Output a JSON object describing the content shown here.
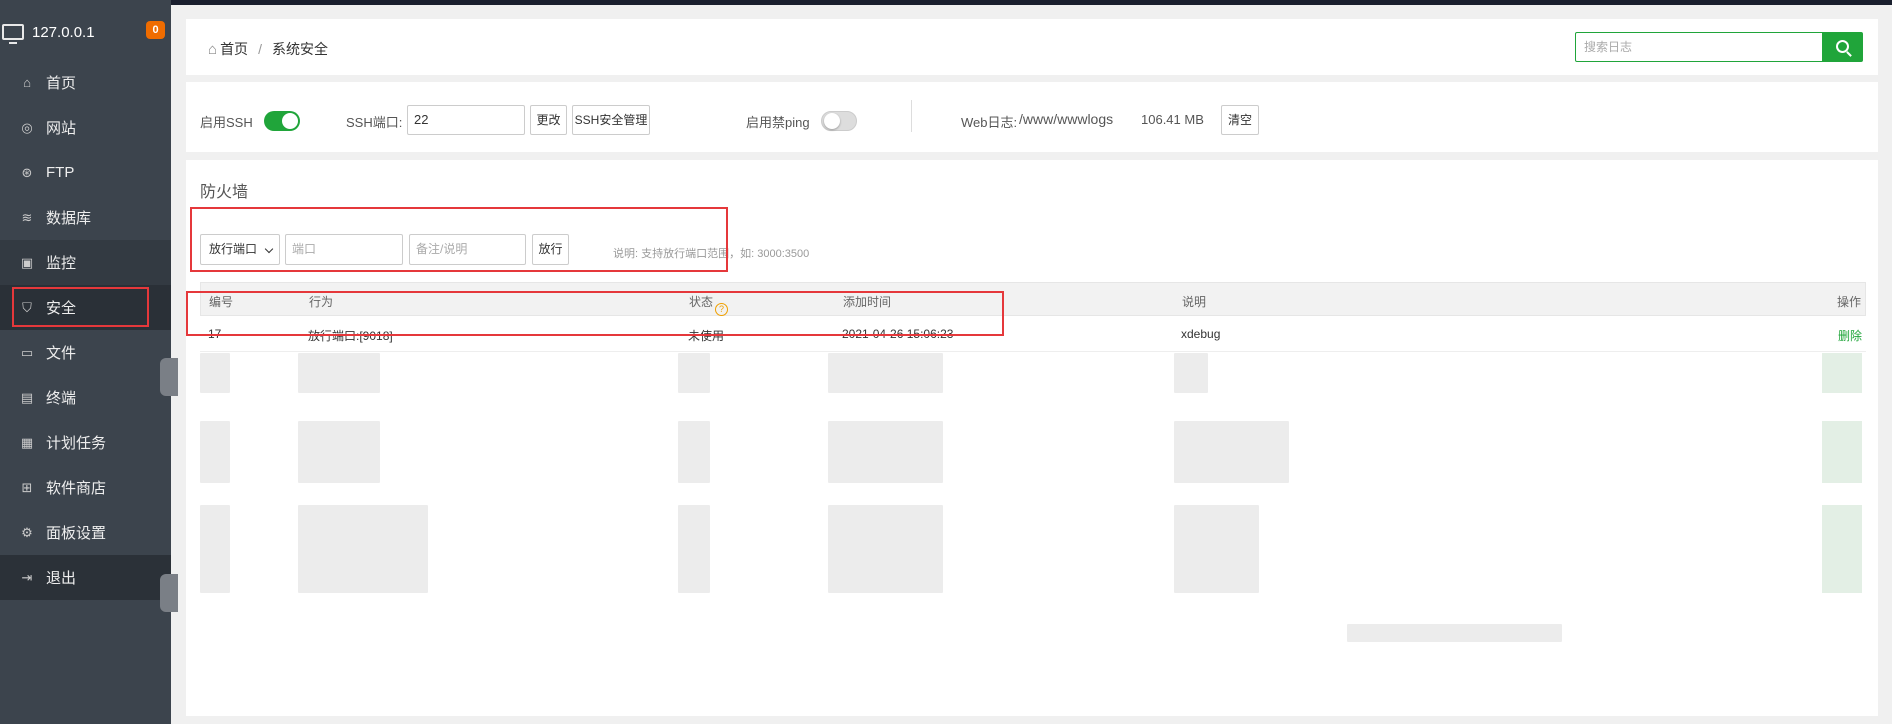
{
  "sidebar": {
    "host": "127.0.0.1",
    "badge": "0",
    "items": [
      {
        "label": "首页",
        "icon": "home-icon"
      },
      {
        "label": "网站",
        "icon": "globe-icon"
      },
      {
        "label": "FTP",
        "icon": "ftp-icon"
      },
      {
        "label": "数据库",
        "icon": "database-icon"
      },
      {
        "label": "监控",
        "icon": "monitor-icon"
      },
      {
        "label": "安全",
        "icon": "shield-icon"
      },
      {
        "label": "文件",
        "icon": "folder-icon"
      },
      {
        "label": "终端",
        "icon": "terminal-icon"
      },
      {
        "label": "计划任务",
        "icon": "calendar-icon"
      },
      {
        "label": "软件商店",
        "icon": "apps-icon"
      },
      {
        "label": "面板设置",
        "icon": "gear-icon"
      },
      {
        "label": "退出",
        "icon": "logout-icon"
      }
    ]
  },
  "breadcrumb": {
    "home": "首页",
    "separator": "/",
    "current": "系统安全"
  },
  "search": {
    "placeholder": "搜索日志"
  },
  "ssh": {
    "enable_label": "启用SSH",
    "port_label": "SSH端口:",
    "port_value": "22",
    "change_btn": "更改",
    "manage_btn": "SSH安全管理",
    "ping_label": "启用禁ping",
    "weblog_label": "Web日志:",
    "weblog_path": "/www/wwwlogs",
    "weblog_size": "106.41 MB",
    "clear_btn": "清空"
  },
  "firewall": {
    "title": "防火墙",
    "select_value": "放行端口",
    "port_placeholder": "端口",
    "note_placeholder": "备注/说明",
    "allow_btn": "放行",
    "hint": "说明: 支持放行端口范围，如: 3000:3500",
    "columns": [
      "编号",
      "行为",
      "状态",
      "添加时间",
      "说明",
      "操作"
    ],
    "status_help": "?",
    "rows": [
      {
        "id": "17",
        "action": "放行端口:[9018]",
        "status": "未使用",
        "time": "2021-04-26 15:06:23",
        "desc": "xdebug",
        "op": "删除"
      }
    ]
  },
  "colors": {
    "accent": "#20a53a",
    "highlight": "#e5383b",
    "sidebar": "#3c444d"
  }
}
